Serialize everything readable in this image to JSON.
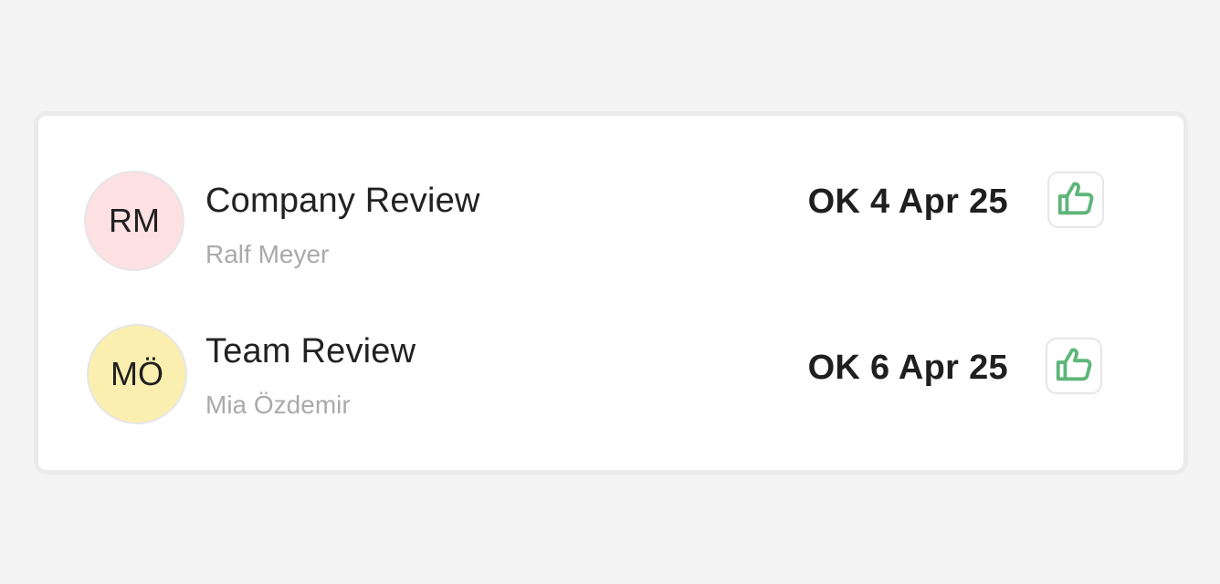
{
  "colors": {
    "background": "#f4f4f4",
    "card": "#ffffff",
    "thumb_green": "#5fb57a"
  },
  "reviews": [
    {
      "initials": "RM",
      "avatar_color": "#fde0e2",
      "title": "Company Review",
      "person": "Ralf Meyer",
      "status": "OK 4 Apr 25",
      "action_icon": "thumbs-up-icon"
    },
    {
      "initials": "MÖ",
      "avatar_color": "#fbefb0",
      "title": "Team Review",
      "person": "Mia Özdemir",
      "status": "OK 6 Apr 25",
      "action_icon": "thumbs-up-icon"
    }
  ]
}
